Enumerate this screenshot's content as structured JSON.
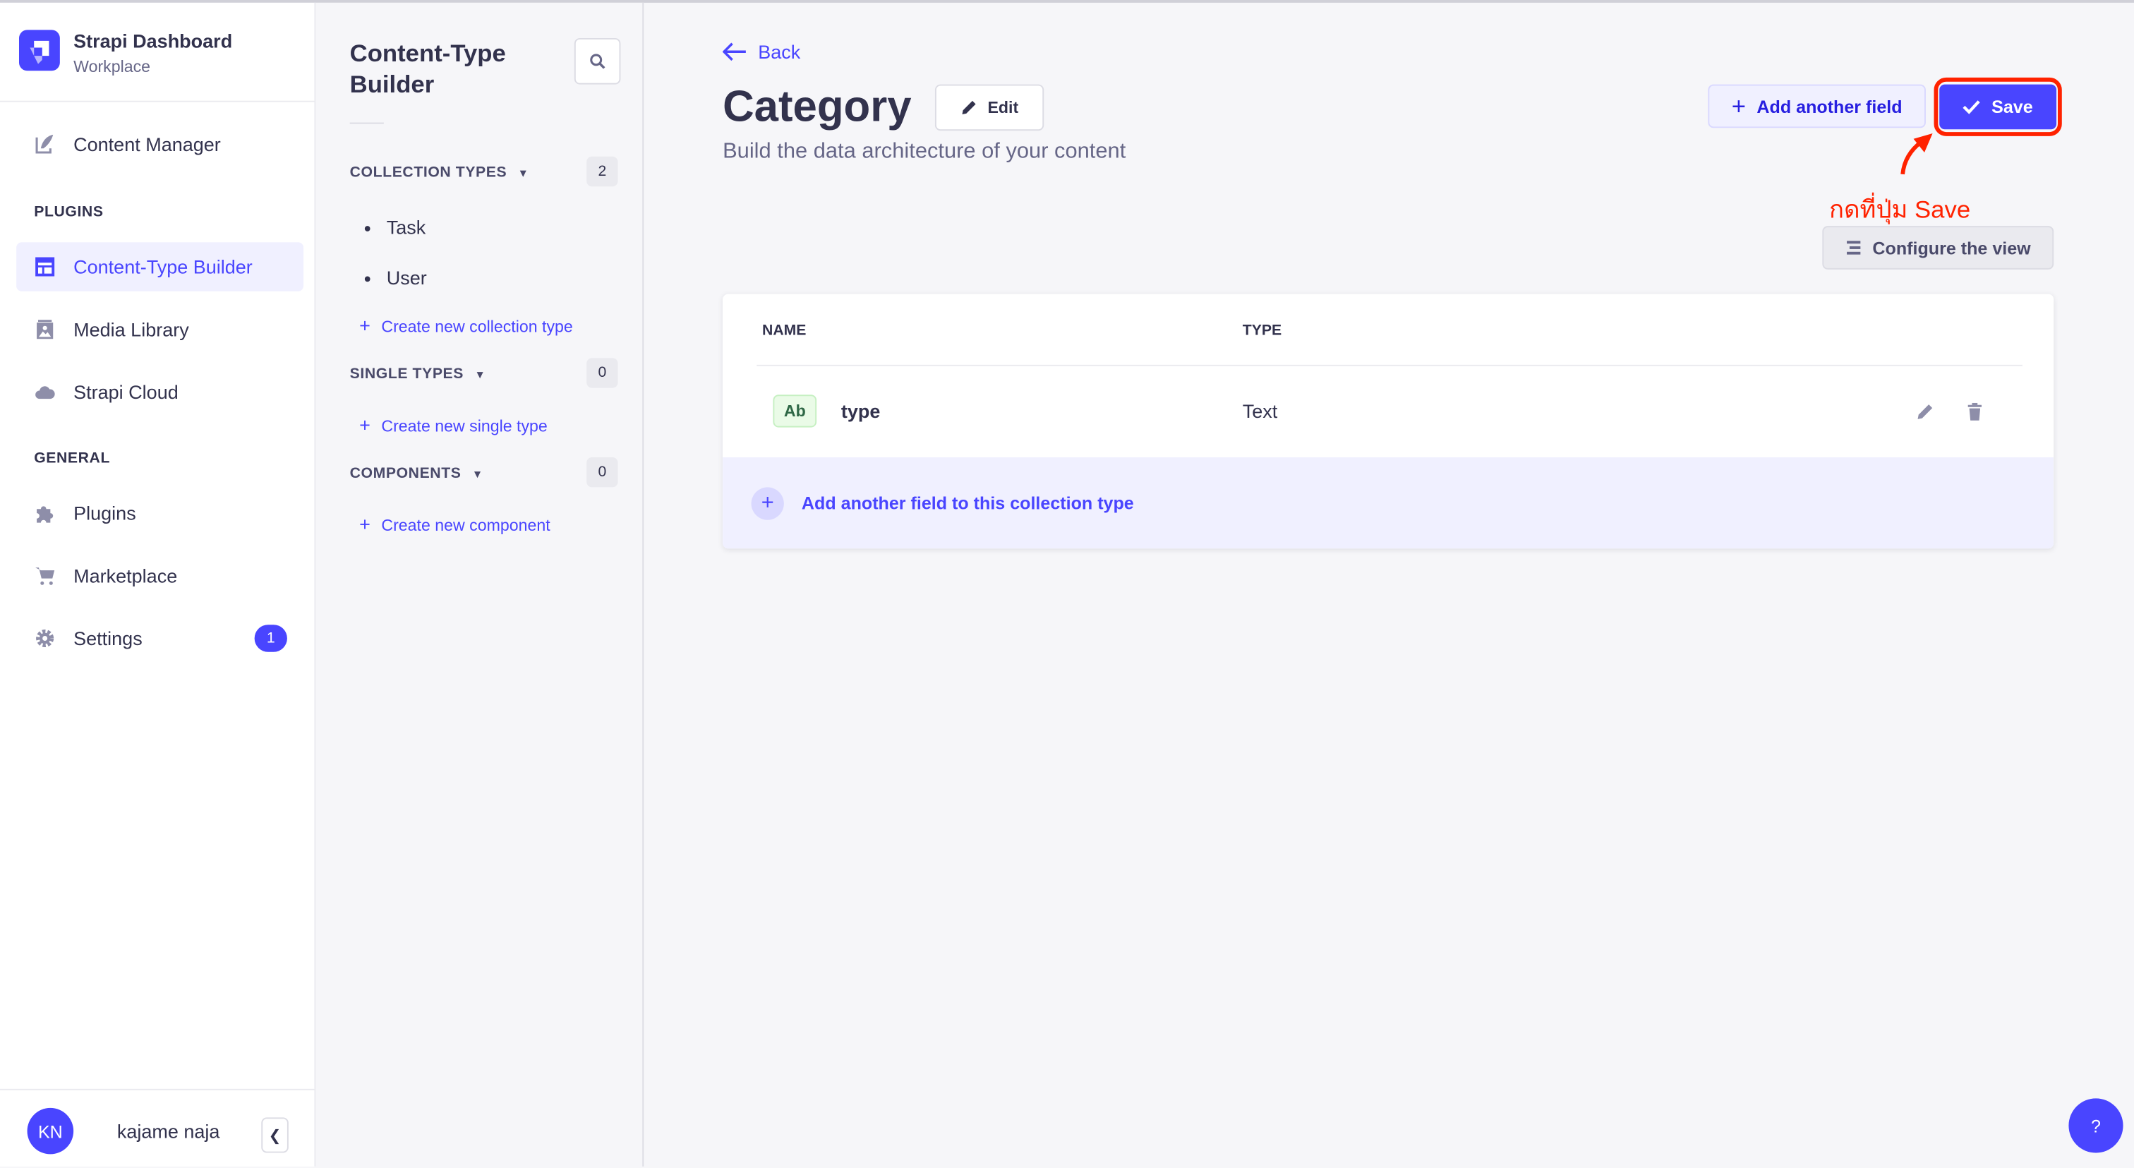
{
  "brand": {
    "title": "Strapi Dashboard",
    "subtitle": "Workplace"
  },
  "nav": {
    "content_manager": "Content Manager",
    "plugins_section": "PLUGINS",
    "content_type_builder": "Content-Type Builder",
    "media_library": "Media Library",
    "strapi_cloud": "Strapi Cloud",
    "general_section": "GENERAL",
    "plugins": "Plugins",
    "marketplace": "Marketplace",
    "settings": "Settings",
    "settings_badge": "1"
  },
  "user": {
    "initials": "KN",
    "name": "kajame naja"
  },
  "subnav": {
    "title": "Content-Type Builder",
    "collection_types": {
      "label": "COLLECTION TYPES",
      "count": "2",
      "items": [
        "Task",
        "User"
      ],
      "create": "Create new collection type"
    },
    "single_types": {
      "label": "SINGLE TYPES",
      "count": "0",
      "create": "Create new single type"
    },
    "components": {
      "label": "COMPONENTS",
      "count": "0",
      "create": "Create new component"
    }
  },
  "main": {
    "back": "Back",
    "title": "Category",
    "edit": "Edit",
    "subtitle": "Build the data architecture of your content",
    "add_another_field": "Add another field",
    "save": "Save",
    "annotation": "กดที่ปุ่ม Save",
    "configure_view": "Configure the view",
    "table": {
      "headers": [
        "NAME",
        "TYPE"
      ],
      "rows": [
        {
          "badge": "Ab",
          "name": "type",
          "type": "Text"
        }
      ],
      "add_field": "Add another field to this collection type"
    },
    "help": "?"
  },
  "colors": {
    "accent": "#4945ff",
    "annotation": "#ff2200",
    "text": "#32324d"
  }
}
